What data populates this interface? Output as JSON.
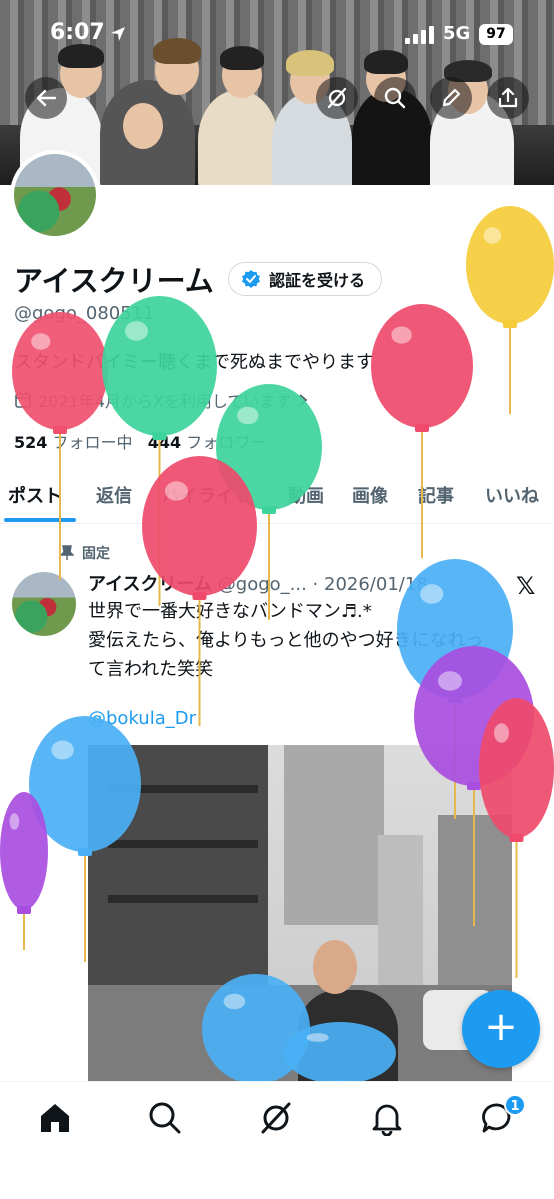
{
  "status_bar": {
    "time": "6:07",
    "network": "5G",
    "battery": "97"
  },
  "profile": {
    "name": "アイスクリーム",
    "verify_label": "認証を受ける",
    "handle": "@gogo_080511",
    "bio": "スタンドバイミー聴くまで死ぬまでやります",
    "joined": "2021年4月からXを利用しています",
    "following_count": "524",
    "following_label": "フォロー中",
    "followers_count": "444",
    "followers_label": "フォロワー"
  },
  "tabs": [
    "ポスト",
    "返信",
    "ハイライト",
    "動画",
    "画像",
    "記事",
    "いいね"
  ],
  "post": {
    "pinned_label": "固定",
    "author": "アイスクリーム",
    "handle": "@gogo_...",
    "date": "· 2026/01/18",
    "body_line1": "世界で一番大好きなバンドマン♬.*",
    "body_line2": "愛伝えたら、俺よりもっと他のやつ好きになれっ",
    "body_line3": "て言われた笑笑",
    "mention": "@bokula_Dr"
  },
  "fab_label": "+",
  "nav": {
    "notification_count": "1"
  },
  "colors": {
    "accent": "#1d9bf0",
    "text": "#0f1419",
    "muted": "#536471"
  }
}
